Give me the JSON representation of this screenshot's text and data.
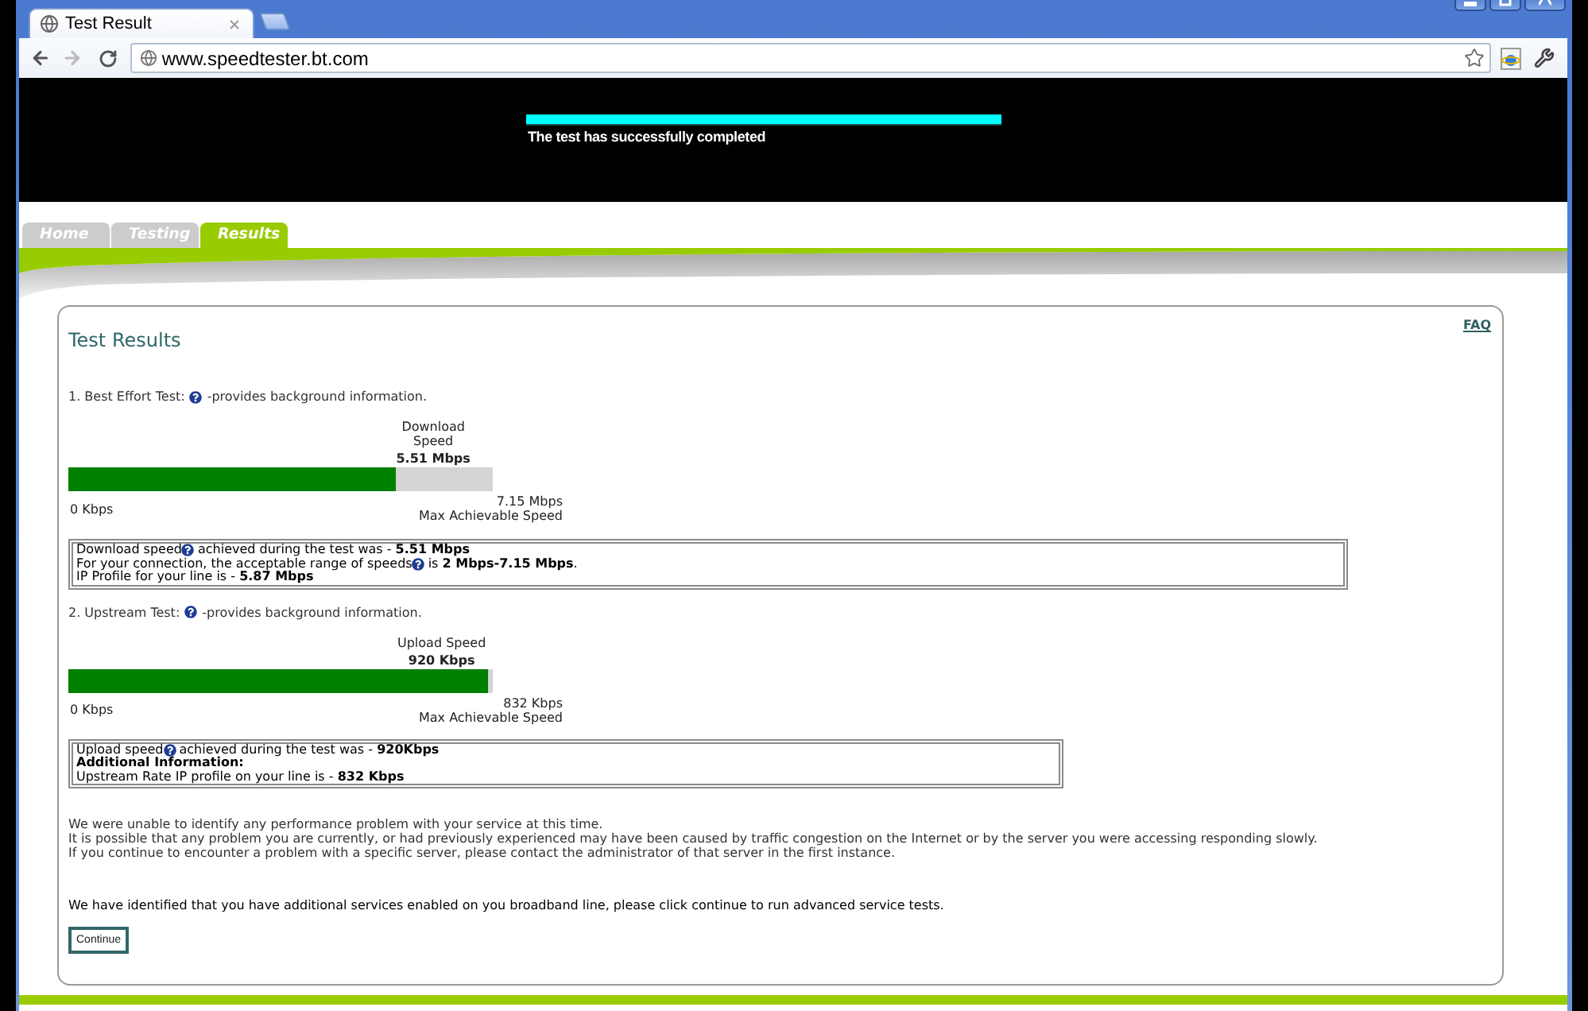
{
  "browser": {
    "tabs": [
      {
        "title": "Test Result",
        "selected": true
      }
    ],
    "address": "www.speedtester.bt.com"
  },
  "banner": {
    "progress": {
      "level": 1
    },
    "message": "The test has successfully completed"
  },
  "nav_tabs": [
    {
      "label": "Home",
      "selected": false
    },
    {
      "label": "Testing",
      "selected": false
    },
    {
      "label": "Results",
      "selected": true
    }
  ],
  "results": {
    "title": "Test Results",
    "faq_link": "FAQ",
    "tests": [
      {
        "label": "1. Best Effort Test:",
        "note": "-provides background information.",
        "speed_label": "Download Speed",
        "speed": "5.51 Mbps",
        "level": 0.77,
        "min_label": "0 Kbps",
        "max_label": "7.15 Mbps",
        "max_caption": "Max Achievable Speed",
        "info": [
          {
            "kind": "text",
            "segments": [
              "Download speed",
              "achieved during the test was - **5.51 Mbps**"
            ]
          },
          {
            "kind": "text",
            "segments": [
              "For your connection, the acceptable range of speeds",
              "is **2 Mbps-7.15 Mbps**."
            ]
          },
          {
            "kind": "text",
            "segments": [
              "IP Profile for your line is - **5.87 Mbps**"
            ]
          }
        ]
      },
      {
        "label": "2. Upstream Test:",
        "note": "-provides background information.",
        "speed_label": "Upload Speed",
        "speed": "920 Kbps",
        "level": 0.99,
        "min_label": "0 Kbps",
        "max_label": "832 Kbps",
        "max_caption": "Max Achievable Speed",
        "info": [
          {
            "kind": "text",
            "segments": [
              "Upload speed",
              "achieved during the test was - **920Kbps**"
            ]
          },
          {
            "kind": "heading",
            "segments": [
              "Additional Information:"
            ]
          },
          {
            "kind": "text",
            "segments": [
              "Upstream Rate IP profile on your line is - **832 Kbps**"
            ]
          }
        ]
      }
    ],
    "message_lines": [
      "We were unable to identify any performance problem with your service at this time.",
      "It is possible that any problem you are currently, or had previously experienced may have been caused by traffic congestion on the Internet or by the server you were accessing responding slowly.",
      "If you continue to encounter a problem with a specific server, please contact the administrator of that server in the first instance."
    ],
    "notice": "We have identified that you have additional services enabled on you broadband line, please click continue to run advanced service tests.",
    "continue_button": "Continue"
  }
}
